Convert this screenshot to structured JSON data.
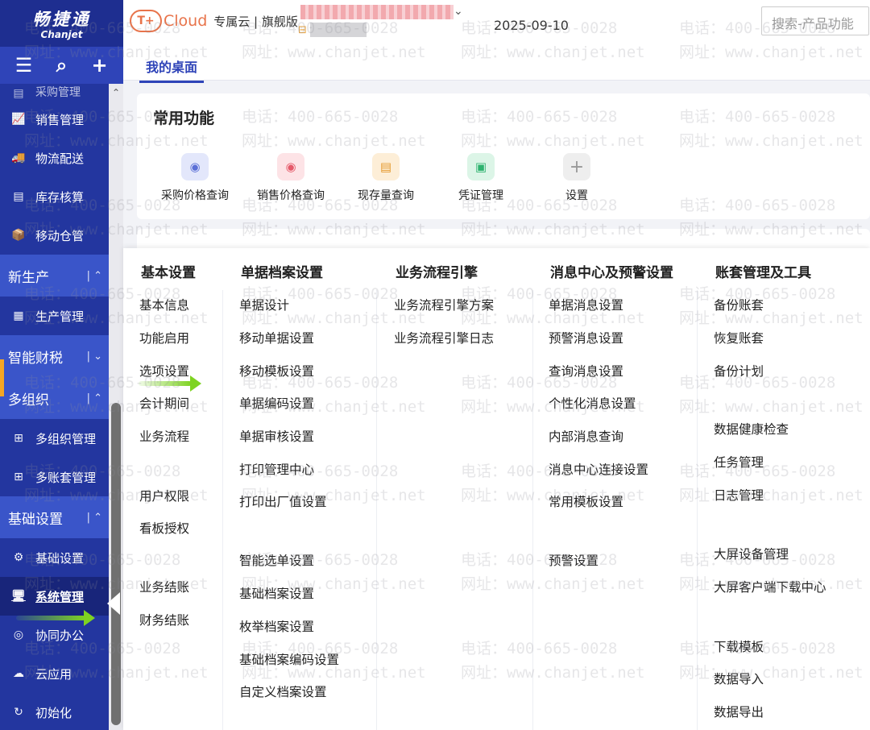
{
  "sidebar": {
    "logo_zh": "畅捷通",
    "logo_en": "Chanjet",
    "tools": [
      "☰",
      "⌕",
      "+"
    ],
    "partial_item": "采购管理",
    "items_top": [
      {
        "label": "销售管理",
        "icon": "📈"
      },
      {
        "label": "物流配送",
        "icon": "🚚"
      },
      {
        "label": "库存核算",
        "icon": "▤"
      },
      {
        "label": "移动仓管",
        "icon": "📦"
      }
    ],
    "group_new_production": "新生产",
    "item_production": {
      "label": "生产管理",
      "icon": "▦"
    },
    "group_finance": "智能财税",
    "group_multi_org": "多组织",
    "items_multi_org": [
      {
        "label": "多组织管理",
        "icon": "⊞"
      },
      {
        "label": "多账套管理",
        "icon": "⊞"
      }
    ],
    "group_basic": "基础设置",
    "item_basic": {
      "label": "基础设置",
      "icon": "⚙"
    },
    "item_system": {
      "label": "系统管理",
      "icon": "🖥"
    },
    "items_bottom": [
      {
        "label": "协同办公",
        "icon": "◎"
      },
      {
        "label": "云应用",
        "icon": "☁"
      },
      {
        "label": "初始化",
        "icon": "↻"
      }
    ]
  },
  "topbar": {
    "brand_text": "Cloud",
    "edition": "专属云 | 旗舰版",
    "date": "2025-09-10",
    "search_placeholder": "搜索-产品功能"
  },
  "tabs": [
    "我的桌面"
  ],
  "common": {
    "title": "常用功能",
    "items": [
      {
        "label": "采购价格查询",
        "icon": "◉",
        "color": "#5b6fd6",
        "bg": "#e3e7fb"
      },
      {
        "label": "销售价格查询",
        "icon": "◉",
        "color": "#e55a6a",
        "bg": "#fde3e6"
      },
      {
        "label": "现存量查询",
        "icon": "▤",
        "color": "#e59a2f",
        "bg": "#fdeed7"
      },
      {
        "label": "凭证管理",
        "icon": "▣",
        "color": "#2fb36f",
        "bg": "#dcf5e7"
      },
      {
        "label": "设置",
        "icon": "+",
        "color": "#999999",
        "bg": "#eeeeee"
      }
    ]
  },
  "menu": {
    "columns": [
      {
        "title": "基本设置",
        "items": [
          "基本信息",
          "功能启用",
          "选项设置",
          "会计期间",
          "业务流程",
          "用户权限",
          "看板授权",
          "业务结账",
          "财务结账"
        ]
      },
      {
        "title": "单据档案设置",
        "items": [
          "单据设计",
          "移动单据设置",
          "移动模板设置",
          "单据编码设置",
          "单据审核设置",
          "打印管理中心",
          "打印出厂值设置",
          "智能选单设置",
          "基础档案设置",
          "枚举档案设置",
          "基础档案编码设置",
          "自定义档案设置"
        ]
      },
      {
        "title": "业务流程引擎",
        "items": [
          "业务流程引擎方案",
          "业务流程引擎日志"
        ]
      },
      {
        "title": "消息中心及预警设置",
        "items": [
          "单据消息设置",
          "预警消息设置",
          "查询消息设置",
          "个性化消息设置",
          "内部消息查询",
          "消息中心连接设置",
          "常用模板设置",
          "预警设置"
        ]
      },
      {
        "title": "账套管理及工具",
        "items": [
          "备份账套",
          "恢复账套",
          "备份计划",
          "数据健康检查",
          "任务管理",
          "日志管理",
          "大屏设备管理",
          "大屏客户端下载中心",
          "下载模板",
          "数据导入",
          "数据导出"
        ]
      }
    ]
  },
  "watermark": {
    "phone": "电话：400-665-0028",
    "site": "网址：www.chanjet.net"
  }
}
